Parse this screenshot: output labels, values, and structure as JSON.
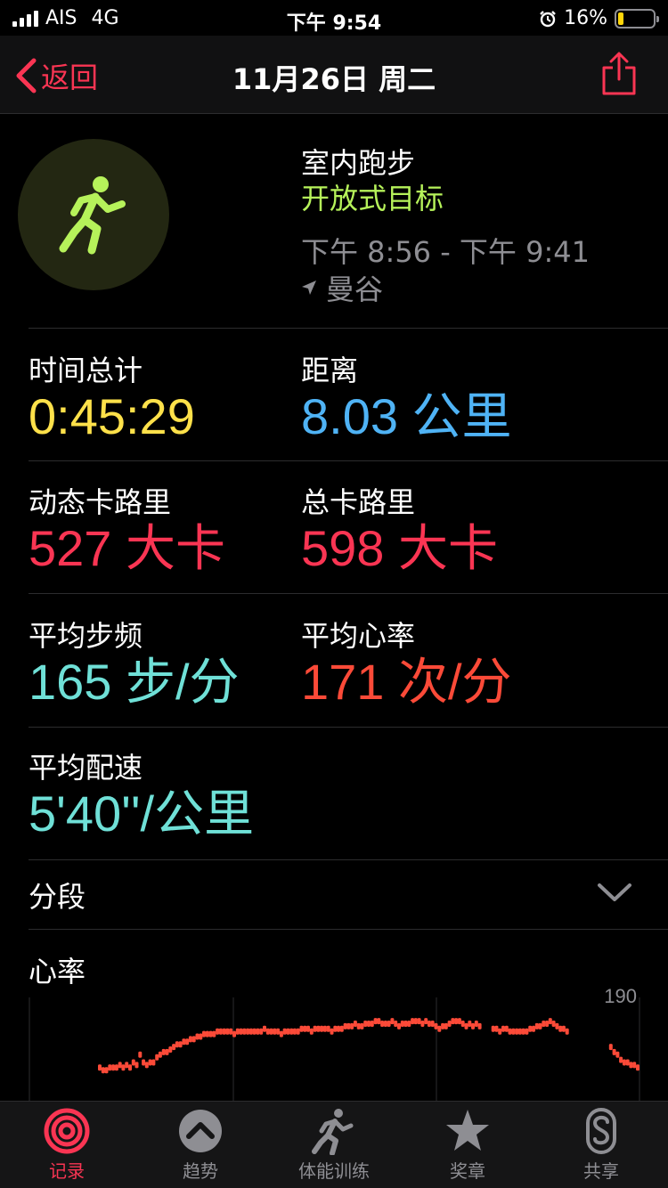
{
  "status_bar": {
    "carrier": "AIS",
    "network": "4G",
    "time": "下午 9:54",
    "battery": "16%",
    "battery_color": "#ffd60a"
  },
  "nav": {
    "back_label": "返回",
    "title": "11月26日 周二",
    "accent_color": "#fa3553"
  },
  "workout": {
    "icon": "running-figure-icon",
    "name": "室内跑步",
    "goal": "开放式目标",
    "time_range": "下午 8:56 - 下午 9:41",
    "location": "曼谷"
  },
  "metrics": {
    "total_time": {
      "label": "时间总计",
      "value": "0:45:29"
    },
    "distance": {
      "label": "距离",
      "value": "8.03 公里"
    },
    "active_cal": {
      "label": "动态卡路里",
      "value": "527 大卡"
    },
    "total_cal": {
      "label": "总卡路里",
      "value": "598 大卡"
    },
    "avg_cadence": {
      "label": "平均步频",
      "value": "165 步/分"
    },
    "avg_hr": {
      "label": "平均心率",
      "value": "171 次/分"
    },
    "avg_pace": {
      "label": "平均配速",
      "value": "5'40''/公里"
    }
  },
  "segments": {
    "label": "分段"
  },
  "heart_rate": {
    "title": "心率",
    "max_label": "190"
  },
  "chart_data": {
    "type": "scatter",
    "title": "心率",
    "ylim": [
      150,
      190
    ],
    "y_tick_labels": [
      "190"
    ],
    "series": [
      {
        "values": [
          163,
          162,
          162,
          163,
          163,
          163,
          164,
          163,
          164,
          163,
          165,
          164,
          168,
          165,
          164,
          165,
          165,
          167,
          168,
          169,
          169,
          170,
          171,
          172,
          172,
          173,
          173,
          174,
          174,
          175,
          175,
          176,
          176,
          176,
          176,
          177,
          177,
          177,
          177,
          177,
          176,
          177,
          177,
          177,
          177,
          177,
          177,
          177,
          177,
          178,
          177,
          177,
          177,
          177,
          176,
          177,
          177,
          177,
          177,
          177,
          178,
          178,
          178,
          177,
          178,
          178,
          178,
          178,
          178,
          177,
          178,
          178,
          178,
          179,
          179,
          179,
          180,
          179,
          179,
          180,
          180,
          180,
          181,
          181,
          180,
          180,
          180,
          181,
          180,
          179,
          180,
          180,
          180,
          181,
          181,
          181,
          180,
          181,
          180,
          180,
          179,
          178,
          179,
          179,
          180,
          181,
          181,
          181,
          180,
          179,
          180,
          179,
          180,
          179,
          null,
          null,
          null,
          178,
          178,
          177,
          178,
          178,
          177,
          177,
          177,
          177,
          177,
          177,
          178,
          178,
          179,
          179,
          180,
          180,
          181,
          180,
          179,
          178,
          178,
          177,
          null,
          null,
          null,
          null,
          null,
          null,
          null,
          null,
          null,
          null,
          null,
          null,
          171,
          169,
          168,
          166,
          165,
          165,
          164,
          164,
          163
        ]
      }
    ]
  },
  "tabs": [
    {
      "label": "记录",
      "icon": "activity-rings-icon",
      "active": true
    },
    {
      "label": "趋势",
      "icon": "trends-chevron-icon",
      "active": false
    },
    {
      "label": "体能训练",
      "icon": "workout-runner-icon",
      "active": false
    },
    {
      "label": "奖章",
      "icon": "awards-star-icon",
      "active": false
    },
    {
      "label": "共享",
      "icon": "sharing-icon",
      "active": false
    }
  ]
}
